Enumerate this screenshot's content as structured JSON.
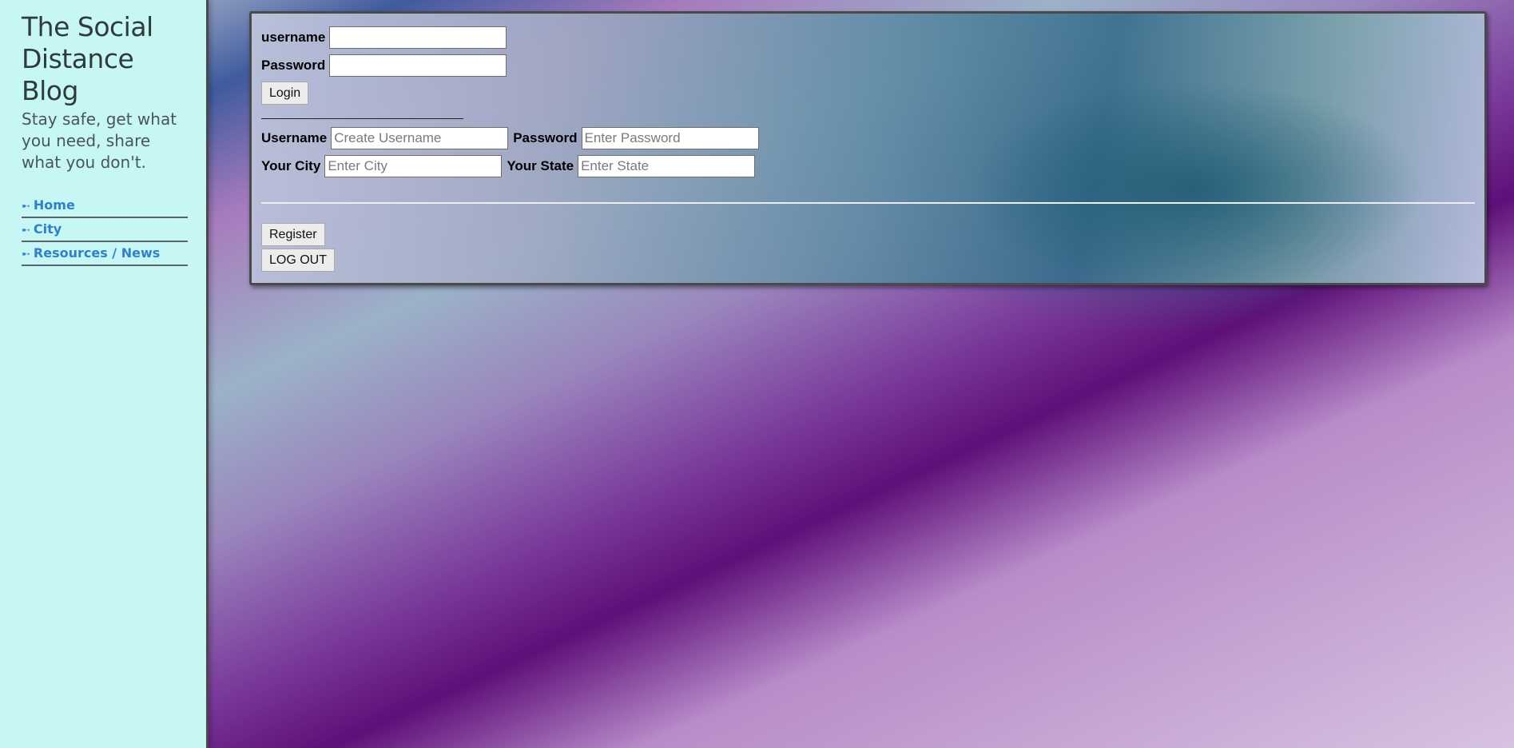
{
  "sidebar": {
    "title": "The Social Distance Blog",
    "tagline": "Stay safe, get what you need, share what you don't.",
    "nav_arrow": "➸",
    "items": [
      {
        "label": "Home"
      },
      {
        "label": "City"
      },
      {
        "label": "Resources / News"
      }
    ]
  },
  "login": {
    "username_label": "username",
    "username_value": "",
    "password_label": "Password",
    "password_value": "",
    "login_button": "Login"
  },
  "register": {
    "username_label": "Username",
    "username_placeholder": "Create Username",
    "password_label": "Password",
    "password_placeholder": "Enter Password",
    "city_label": "Your City",
    "city_placeholder": "Enter City",
    "state_label": "Your State",
    "state_placeholder": "Enter State",
    "register_button": "Register",
    "logout_button": "LOG OUT"
  },
  "colors": {
    "sidebar_bg": "#c6f7f5",
    "nav_link": "#2f7fcf",
    "title_text": "#2f3b3a"
  }
}
